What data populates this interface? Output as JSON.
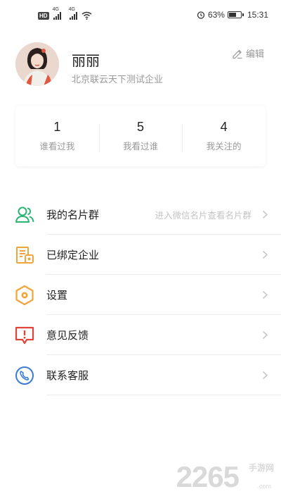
{
  "status_bar": {
    "hd_badge": "HD",
    "net_1": "4G",
    "net_2": "4G",
    "battery_percent": "63%",
    "battery_level": 0.63,
    "time": "15:31"
  },
  "profile": {
    "name": "丽丽",
    "company": "北京联云天下测试企业",
    "edit_label": "编辑"
  },
  "stats": [
    {
      "value": "1",
      "label": "谁看过我"
    },
    {
      "value": "5",
      "label": "我看过谁"
    },
    {
      "value": "4",
      "label": "我关注的"
    }
  ],
  "menu": {
    "items": [
      {
        "label": "我的名片群",
        "hint": "进入微信名片查看名片群",
        "icon": "contacts-icon"
      },
      {
        "label": "已绑定企业",
        "icon": "enterprise-icon"
      },
      {
        "label": "设置",
        "icon": "settings-icon"
      },
      {
        "label": "意见反馈",
        "icon": "feedback-icon"
      },
      {
        "label": "联系客服",
        "icon": "phone-icon"
      }
    ]
  },
  "watermark": {
    "number": "2265",
    "text": "手游网",
    "domain": ".com"
  },
  "colors": {
    "contacts_icon": "#2bb673",
    "enterprise_icon": "#f0a43a",
    "settings_icon": "#f0a43a",
    "feedback_icon": "#e0443a",
    "phone_icon": "#3a7bd5"
  }
}
